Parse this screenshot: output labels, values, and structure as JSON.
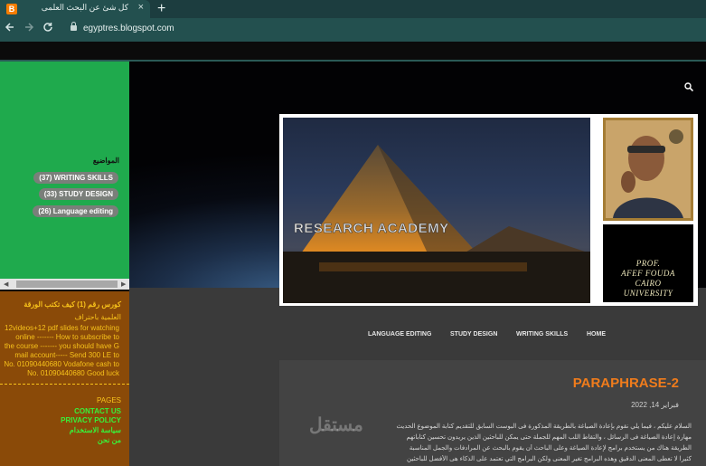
{
  "browser": {
    "tab_title": "كل شئ عن البحث العلمى",
    "new_tab": "+",
    "close": "×",
    "url": "egyptres.blogspot.com",
    "favicon_letter": "B"
  },
  "sidebar": {
    "heading": "المواضيع",
    "tags": [
      "(37) WRITING SKILLS",
      "(33) STUDY DESIGN",
      "(26) Language editing"
    ]
  },
  "sidebar_box": {
    "title": "كورس رقم (1) كيف تكتب الورقة",
    "subtitle": "العلمية باحتراف",
    "body": "12videos+12 pdf slides for watching online ------- How to subscribe to the course ------- you should have G mail account----- Send 300 LE to No. 01090440680 Vodafone cash to No. 01090440680 Good luck",
    "pages_heading": "PAGES",
    "links": [
      "CONTACT US",
      "PRIVACY POLICY",
      "سياسة الاستخدام",
      "من نحن"
    ]
  },
  "header": {
    "image_text": "RESEARCH ACADEMY",
    "card_lines": [
      "PROF.",
      "AFEF FOUDA",
      "CAIRO",
      "UNIVERSITY"
    ]
  },
  "nav": [
    "LANGUAGE EDITING",
    "STUDY DESIGN",
    "WRITING SKILLS",
    "HOME"
  ],
  "post": {
    "title": "PARAPHRASE-2",
    "date": "فبراير 14, 2022",
    "lines": [
      "السلام عليكم ، فيما يلي نقوم بإعادة الصياغة بالطريقة المذكورة فى البوست السابق للتقديم كتابة الموضوع الحديث",
      "مهارة إعادة الصياغة فى الرسائل ، والتقاط اللب المهم للجملة حتى يمكن للباحثين الذين يريدون تحسين كتاباتهم",
      "الطريقة هناك من يستخدم برامج لإعادة الصياغة وعلى الباحث أن يقوم بالبحث عن المرادفات والجمل المناسبة",
      "كثيرا لا تعطى المعنى الدقيق وهذه البرامج تغير المعنى ولكن البرامج التي تعتمد على الذكاء هى الأفضل للباحثين"
    ],
    "watermark": "مستقل"
  },
  "colors": {
    "sidebar_green": "#1faa4d",
    "sidebar_orange": "#8a4a08",
    "post_title": "#f07c1c"
  }
}
